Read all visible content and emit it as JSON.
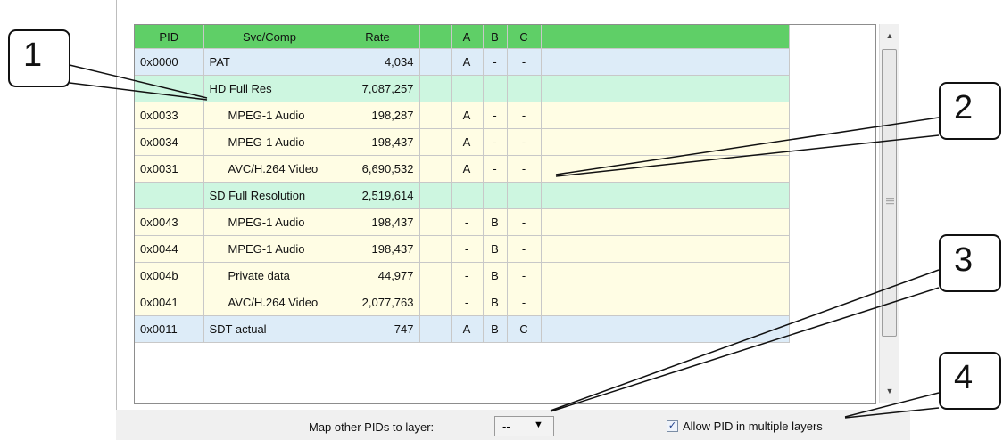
{
  "table": {
    "columns": [
      "PID",
      "Svc/Comp",
      "Rate",
      "",
      "A",
      "B",
      "C",
      ""
    ],
    "rows": [
      {
        "pid": "0x0000",
        "svc": "PAT",
        "rate": "4,034",
        "a": "A",
        "b": "-",
        "c": "-",
        "color": "blue",
        "indent": false
      },
      {
        "pid": "",
        "svc": "HD Full Res",
        "rate": "7,087,257",
        "a": "",
        "b": "",
        "c": "",
        "color": "green",
        "indent": false
      },
      {
        "pid": "0x0033",
        "svc": "MPEG-1 Audio",
        "rate": "198,287",
        "a": "A",
        "b": "-",
        "c": "-",
        "color": "yellow",
        "indent": true
      },
      {
        "pid": "0x0034",
        "svc": "MPEG-1 Audio",
        "rate": "198,437",
        "a": "A",
        "b": "-",
        "c": "-",
        "color": "yellow",
        "indent": true
      },
      {
        "pid": "0x0031",
        "svc": "AVC/H.264 Video",
        "rate": "6,690,532",
        "a": "A",
        "b": "-",
        "c": "-",
        "color": "yellow",
        "indent": true
      },
      {
        "pid": "",
        "svc": "SD Full Resolution",
        "rate": "2,519,614",
        "a": "",
        "b": "",
        "c": "",
        "color": "green",
        "indent": false
      },
      {
        "pid": "0x0043",
        "svc": "MPEG-1 Audio",
        "rate": "198,437",
        "a": "-",
        "b": "B",
        "c": "-",
        "color": "yellow",
        "indent": true
      },
      {
        "pid": "0x0044",
        "svc": "MPEG-1 Audio",
        "rate": "198,437",
        "a": "-",
        "b": "B",
        "c": "-",
        "color": "yellow",
        "indent": true
      },
      {
        "pid": "0x004b",
        "svc": "Private data",
        "rate": "44,977",
        "a": "-",
        "b": "B",
        "c": "-",
        "color": "yellow",
        "indent": true
      },
      {
        "pid": "0x0041",
        "svc": "AVC/H.264 Video",
        "rate": "2,077,763",
        "a": "-",
        "b": "B",
        "c": "-",
        "color": "yellow",
        "indent": true
      },
      {
        "pid": "0x0011",
        "svc": "SDT actual",
        "rate": "747",
        "a": "A",
        "b": "B",
        "c": "C",
        "color": "blue",
        "indent": false
      }
    ]
  },
  "controls": {
    "map_label": "Map other PIDs to layer:",
    "map_value": "--",
    "allow_label": "Allow PID in multiple layers",
    "allow_checked": true
  },
  "callouts": [
    "1",
    "2",
    "3",
    "4"
  ],
  "colors": {
    "header": "#5fcf67",
    "row_blue": "#ddecf8",
    "row_green": "#cdf6e0",
    "row_yellow": "#fffde4"
  }
}
